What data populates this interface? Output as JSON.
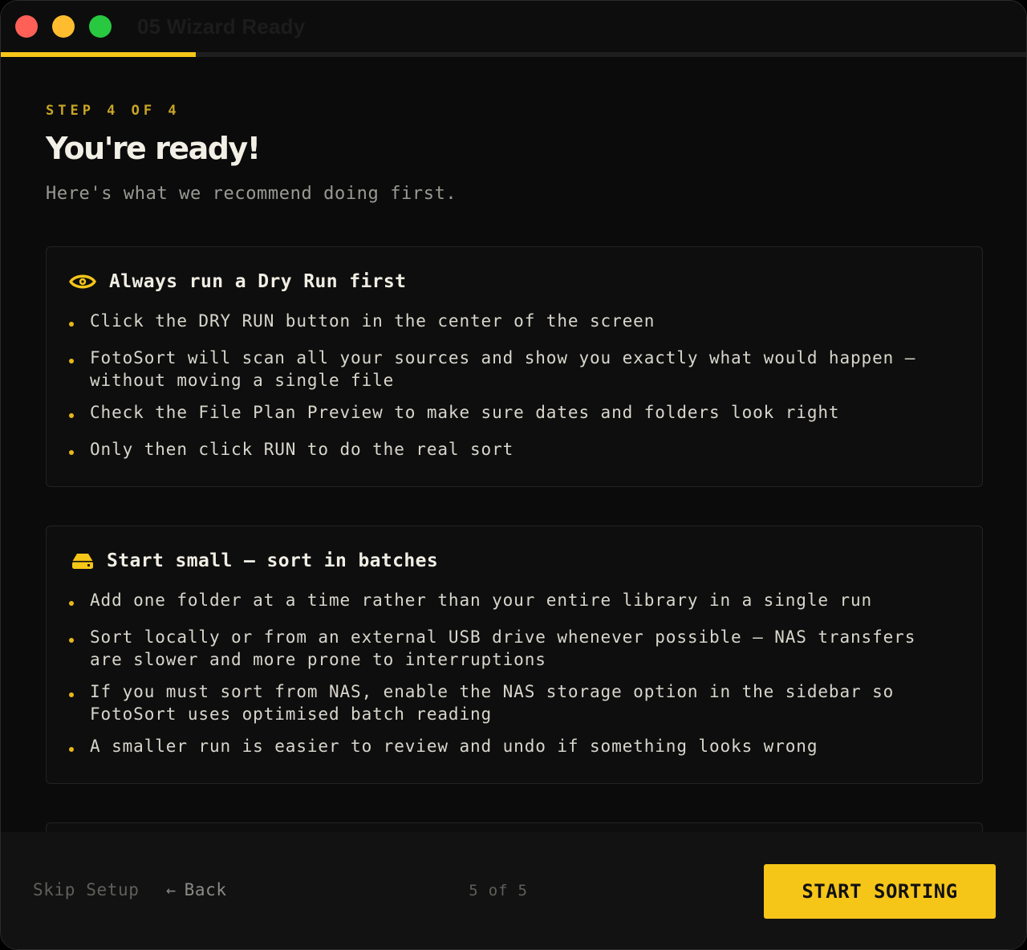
{
  "window": {
    "title": "05 Wizard Ready",
    "progress": 0.19
  },
  "header": {
    "step_label": "STEP 4 OF 4",
    "title": "You're ready!",
    "subtitle": "Here's what we recommend doing first."
  },
  "cards": [
    {
      "icon": "eye-icon",
      "title": "Always run a Dry Run first",
      "bullets": [
        "Click the DRY RUN button in the center of the screen",
        "FotoSort will scan all your sources and show you exactly what would happen — without moving a single file",
        "Check the File Plan Preview to make sure dates and folders look right",
        "Only then click RUN to do the real sort"
      ]
    },
    {
      "icon": "drive-icon",
      "title": "Start small — sort in batches",
      "bullets": [
        "Add one folder at a time rather than your entire library in a single run",
        "Sort locally or from an external USB drive whenever possible — NAS transfers are slower and more prone to interruptions",
        "If you must sort from NAS, enable the NAS storage option in the sidebar so FotoSort uses optimised batch reading",
        "A smaller run is easier to review and undo if something looks wrong"
      ]
    }
  ],
  "footer": {
    "skip_label": "Skip Setup",
    "back_label": "Back",
    "page_counter": "5 of 5",
    "start_label": "START SORTING"
  },
  "colors": {
    "accent": "#f5c518",
    "background": "#0b0b0b",
    "text": "#d8d6cc"
  }
}
